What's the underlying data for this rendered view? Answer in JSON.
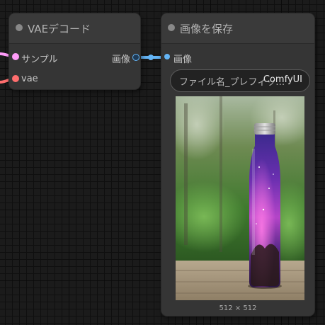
{
  "nodes": {
    "vae_decode": {
      "title": "VAEデコード",
      "inputs": [
        {
          "label": "サンプル",
          "color": "#ff9cf9"
        },
        {
          "label": "vae",
          "color": "#ff6e6e"
        }
      ],
      "output": {
        "label": "画像",
        "color": "#64b5f6"
      }
    },
    "save_image": {
      "title": "画像を保存",
      "input": {
        "label": "画像",
        "color": "#64b5f6"
      },
      "widget": {
        "label": "ファイル名_プレフィッ…",
        "value": "ComfyUI"
      },
      "preview": {
        "subject": "glass bottle with purple galaxy pattern on a wooden table, blurred green trees background",
        "size_label": "512 × 512"
      }
    }
  },
  "colors": {
    "canvas": "#1b1b1b",
    "node_body": "#353535",
    "image_link": "#64b5f6",
    "latent_link": "#ff9cf9",
    "vae_link": "#ff6e6e"
  }
}
